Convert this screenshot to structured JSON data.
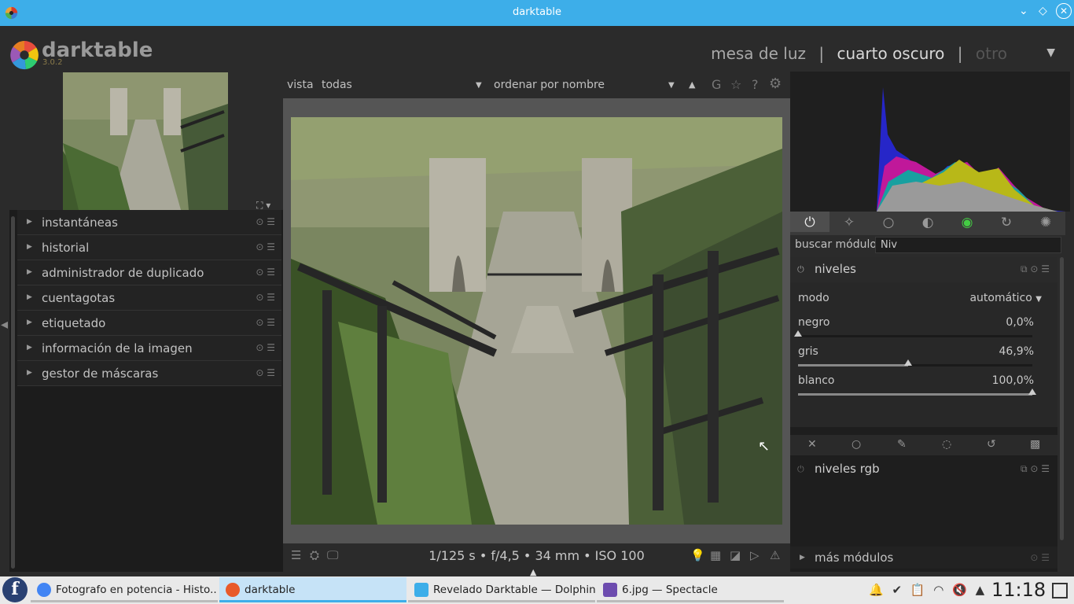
{
  "window": {
    "title": "darktable"
  },
  "header": {
    "app_name": "darktable",
    "version": "3.0.2",
    "views": {
      "lighttable": "mesa de luz",
      "sep": "|",
      "darkroom": "cuarto oscuro",
      "other": "otro"
    }
  },
  "left_modules": [
    {
      "label": "instantáneas"
    },
    {
      "label": "historial"
    },
    {
      "label": "administrador de duplicado"
    },
    {
      "label": "cuentagotas"
    },
    {
      "label": "etiquetado"
    },
    {
      "label": "información de la imagen"
    },
    {
      "label": "gestor de máscaras"
    }
  ],
  "filmstrip_bar": {
    "view_label": "vista",
    "view_value": "todas",
    "sort_label": "ordenar por",
    "sort_value": "nombre",
    "g_label": "G"
  },
  "image_info": {
    "exif": "1/125 s • f/4,5 • 34 mm • ISO 100"
  },
  "right_panel": {
    "search_label": "buscar módulo",
    "search_value": "Niv",
    "module_levels": {
      "title": "niveles",
      "mode_label": "modo",
      "mode_value": "automático",
      "sliders": [
        {
          "label": "negro",
          "value_text": "0,0%",
          "value": 0.0
        },
        {
          "label": "gris",
          "value_text": "46,9%",
          "value": 0.469
        },
        {
          "label": "blanco",
          "value_text": "100,0%",
          "value": 1.0
        }
      ]
    },
    "module_rgb_levels": {
      "title": "niveles rgb"
    },
    "more_modules": "más módulos"
  },
  "taskbar": {
    "tasks": [
      {
        "label": "Fotografo en potencia - Histo...",
        "color": "#4285f4"
      },
      {
        "label": "darktable",
        "color": "#e85a2a"
      },
      {
        "label": "Revelado Darktable — Dolphin",
        "color": "#3daee9"
      },
      {
        "label": "6.jpg — Spectacle",
        "color": "#6d4caf"
      }
    ],
    "clock": "11:18"
  },
  "colors": {
    "accent": "#3daee9",
    "panel": "#2b2b2b",
    "taskbar": "#e9e9e9"
  }
}
